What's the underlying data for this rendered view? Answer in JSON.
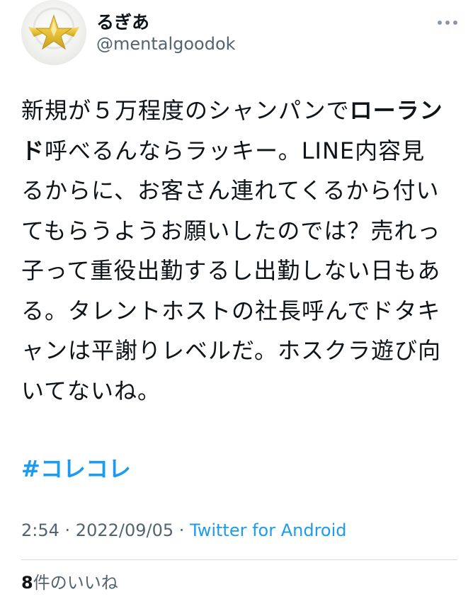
{
  "author": {
    "display_name": "るぎあ",
    "handle": "@mentalgoodok",
    "avatar_icon": "gold-star-emblem-icon"
  },
  "menu": {
    "icon": "more-horizontal-icon"
  },
  "tweet": {
    "text_part1": "新規が５万程度のシャンパンで",
    "bold_name": "ローランド",
    "text_part2": "呼べるんならラッキー。LINE内容見るからに、お客さん連れてくるから付いてもらうようお願いしたのでは？売れっ子って重役出勤するし出勤しない日もある。タレントホストの社長呼んでドタキャンは平謝りレベルだ。ホスクラ遊び向いてないね。",
    "hashtag": "#コレコレ"
  },
  "meta": {
    "time": "2:54",
    "sep1": " · ",
    "date": "2022/09/05",
    "sep2": " · ",
    "source": "Twitter for Android"
  },
  "stats": {
    "likes_count": "8",
    "likes_label": "件のいいね"
  },
  "colors": {
    "link": "#1d9bf0",
    "secondary_text": "#536471",
    "primary_text": "#0f1419",
    "avatar_gold": "#e8c23a"
  }
}
